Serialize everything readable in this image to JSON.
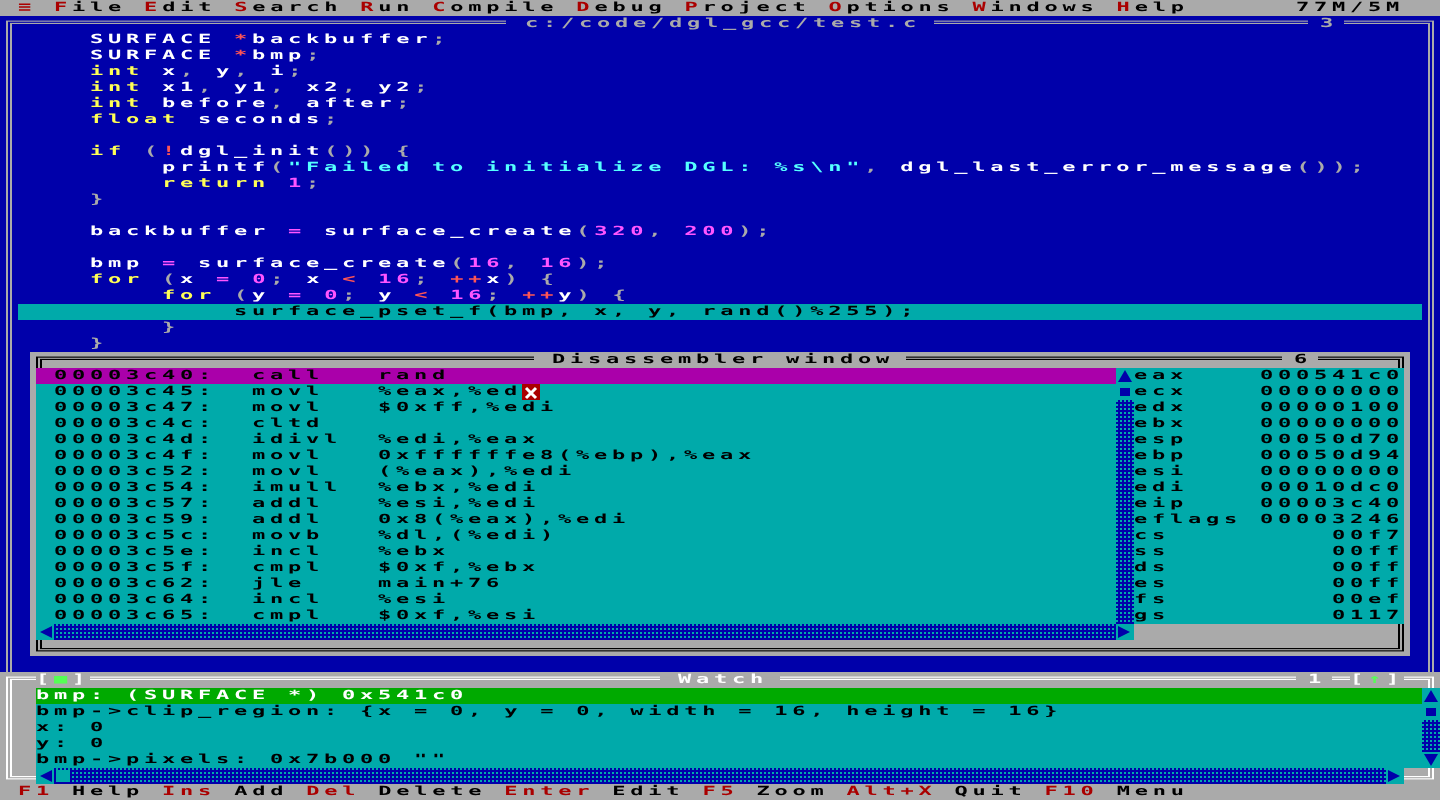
{
  "menu_bar": {
    "items": [
      "≡",
      "File",
      "Edit",
      "Search",
      "Run",
      "Compile",
      "Debug",
      "Project",
      "Options",
      "Windows",
      "Help"
    ],
    "memory": "77M/5M"
  },
  "editor": {
    "title": "c:/code/dgl_gcc/test.c",
    "number": "3",
    "lines": [
      {
        "current": false,
        "tokens": [
          {
            "text": "SURFACE ",
            "kind": "plain"
          },
          {
            "text": "*",
            "kind": "op"
          },
          {
            "text": "backbuffer",
            "kind": "plain"
          },
          {
            "text": ";",
            "kind": "punct"
          }
        ]
      },
      {
        "current": false,
        "tokens": [
          {
            "text": "SURFACE ",
            "kind": "plain"
          },
          {
            "text": "*",
            "kind": "op"
          },
          {
            "text": "bmp",
            "kind": "plain"
          },
          {
            "text": ";",
            "kind": "punct"
          }
        ]
      },
      {
        "current": false,
        "tokens": [
          {
            "text": "int",
            "kind": "keyword"
          },
          {
            "text": " x",
            "kind": "plain"
          },
          {
            "text": ",",
            "kind": "punct"
          },
          {
            "text": " y",
            "kind": "plain"
          },
          {
            "text": ",",
            "kind": "punct"
          },
          {
            "text": " i",
            "kind": "plain"
          },
          {
            "text": ";",
            "kind": "punct"
          }
        ]
      },
      {
        "current": false,
        "tokens": [
          {
            "text": "int",
            "kind": "keyword"
          },
          {
            "text": " x1",
            "kind": "plain"
          },
          {
            "text": ",",
            "kind": "punct"
          },
          {
            "text": " y1",
            "kind": "plain"
          },
          {
            "text": ",",
            "kind": "punct"
          },
          {
            "text": " x2",
            "kind": "plain"
          },
          {
            "text": ",",
            "kind": "punct"
          },
          {
            "text": " y2",
            "kind": "plain"
          },
          {
            "text": ";",
            "kind": "punct"
          }
        ]
      },
      {
        "current": false,
        "tokens": [
          {
            "text": "int",
            "kind": "keyword"
          },
          {
            "text": " before",
            "kind": "plain"
          },
          {
            "text": ",",
            "kind": "punct"
          },
          {
            "text": " after",
            "kind": "plain"
          },
          {
            "text": ";",
            "kind": "punct"
          }
        ]
      },
      {
        "current": false,
        "tokens": [
          {
            "text": "float",
            "kind": "keyword"
          },
          {
            "text": " seconds",
            "kind": "plain"
          },
          {
            "text": ";",
            "kind": "punct"
          }
        ]
      },
      {
        "current": false
      },
      {
        "current": false,
        "tokens": [
          {
            "text": "if",
            "kind": "keyword"
          },
          {
            "text": " (",
            "kind": "punct"
          },
          {
            "text": "!",
            "kind": "op"
          },
          {
            "text": "dgl_init",
            "kind": "plain"
          },
          {
            "text": "()) {",
            "kind": "punct"
          }
        ],
        "children": [
          {
            "current": false,
            "tokens": [
              {
                "text": "printf",
                "kind": "plain"
              },
              {
                "text": "(",
                "kind": "punct"
              },
              {
                "text": "\"Failed to initialize DGL: %s\\n\"",
                "kind": "string"
              },
              {
                "text": ",",
                "kind": "punct"
              },
              {
                "text": " dgl_last_error_message",
                "kind": "plain"
              },
              {
                "text": "());",
                "kind": "punct"
              }
            ]
          },
          {
            "current": false,
            "tokens": [
              {
                "text": "return",
                "kind": "keyword"
              },
              {
                "text": " 1",
                "kind": "number"
              },
              {
                "text": ";",
                "kind": "punct"
              }
            ]
          }
        ]
      },
      {
        "current": false,
        "tokens": [
          {
            "text": "}",
            "kind": "punct"
          }
        ]
      },
      {
        "current": false
      },
      {
        "current": false,
        "tokens": [
          {
            "text": "backbuffer ",
            "kind": "plain"
          },
          {
            "text": "=",
            "kind": "assign"
          },
          {
            "text": " surface_create",
            "kind": "plain"
          },
          {
            "text": "(",
            "kind": "punct"
          },
          {
            "text": "320",
            "kind": "number"
          },
          {
            "text": ", ",
            "kind": "punct"
          },
          {
            "text": "200",
            "kind": "number"
          },
          {
            "text": ");",
            "kind": "punct"
          }
        ]
      },
      {
        "current": false
      },
      {
        "current": false,
        "tokens": [
          {
            "text": "bmp ",
            "kind": "plain"
          },
          {
            "text": "=",
            "kind": "assign"
          },
          {
            "text": " surface_create",
            "kind": "plain"
          },
          {
            "text": "(",
            "kind": "punct"
          },
          {
            "text": "16",
            "kind": "number"
          },
          {
            "text": ", ",
            "kind": "punct"
          },
          {
            "text": "16",
            "kind": "number"
          },
          {
            "text": ");",
            "kind": "punct"
          }
        ]
      },
      {
        "current": false,
        "tokens": [
          {
            "text": "for",
            "kind": "keyword"
          },
          {
            "text": " (",
            "kind": "punct"
          },
          {
            "text": "x ",
            "kind": "plain"
          },
          {
            "text": "=",
            "kind": "assign"
          },
          {
            "text": " 0",
            "kind": "number"
          },
          {
            "text": "; ",
            "kind": "punct"
          },
          {
            "text": "x ",
            "kind": "plain"
          },
          {
            "text": "<",
            "kind": "op"
          },
          {
            "text": " 16",
            "kind": "number"
          },
          {
            "text": "; ",
            "kind": "punct"
          },
          {
            "text": "++",
            "kind": "op"
          },
          {
            "text": "x",
            "kind": "plain"
          },
          {
            "text": ") {",
            "kind": "punct"
          }
        ],
        "children": [
          {
            "current": false,
            "tokens": [
              {
                "text": "for",
                "kind": "keyword"
              },
              {
                "text": " (",
                "kind": "punct"
              },
              {
                "text": "y ",
                "kind": "plain"
              },
              {
                "text": "=",
                "kind": "assign"
              },
              {
                "text": " 0",
                "kind": "number"
              },
              {
                "text": "; ",
                "kind": "punct"
              },
              {
                "text": "y ",
                "kind": "plain"
              },
              {
                "text": "<",
                "kind": "op"
              },
              {
                "text": " 16",
                "kind": "number"
              },
              {
                "text": "; ",
                "kind": "punct"
              },
              {
                "text": "++",
                "kind": "op"
              },
              {
                "text": "y",
                "kind": "plain"
              },
              {
                "text": ") {",
                "kind": "punct"
              }
            ],
            "children": [
              {
                "current": true,
                "text": "surface_pset_f(bmp, x, y, rand()%255);"
              }
            ]
          },
          {
            "current": false,
            "tokens": [
              {
                "text": "}",
                "kind": "punct"
              }
            ]
          }
        ]
      },
      {
        "current": false,
        "tokens": [
          {
            "text": "}",
            "kind": "punct"
          }
        ]
      }
    ]
  },
  "disassembler": {
    "title": "Disassembler window",
    "number": "6",
    "rows": [
      {
        "address": "00003c40:",
        "mnemonic": "call",
        "operand": "rand",
        "current": true,
        "cursor": false
      },
      {
        "address": "00003c45:",
        "mnemonic": "movl",
        "operand": "%eax,%ed",
        "current": false,
        "cursor": true
      },
      {
        "address": "00003c47:",
        "mnemonic": "movl",
        "operand": "$0xff,%edi",
        "current": false,
        "cursor": false
      },
      {
        "address": "00003c4c:",
        "mnemonic": "cltd",
        "current": false,
        "cursor": false
      },
      {
        "address": "00003c4d:",
        "mnemonic": "idivl",
        "operand": "%edi,%eax",
        "current": false,
        "cursor": false
      },
      {
        "address": "00003c4f:",
        "mnemonic": "movl",
        "operand": "0xffffffe8(%ebp),%eax",
        "current": false,
        "cursor": false
      },
      {
        "address": "00003c52:",
        "mnemonic": "movl",
        "operand": "(%eax),%edi",
        "current": false,
        "cursor": false
      },
      {
        "address": "00003c54:",
        "mnemonic": "imull",
        "operand": "%ebx,%edi",
        "current": false,
        "cursor": false
      },
      {
        "address": "00003c57:",
        "mnemonic": "addl",
        "operand": "%esi,%edi",
        "current": false,
        "cursor": false
      },
      {
        "address": "00003c59:",
        "mnemonic": "addl",
        "operand": "0x8(%eax),%edi",
        "current": false,
        "cursor": false
      },
      {
        "address": "00003c5c:",
        "mnemonic": "movb",
        "operand": "%dl,(%edi)",
        "current": false,
        "cursor": false
      },
      {
        "address": "00003c5e:",
        "mnemonic": "incl",
        "operand": "%ebx",
        "current": false,
        "cursor": false
      },
      {
        "address": "00003c5f:",
        "mnemonic": "cmpl",
        "operand": "$0xf,%ebx",
        "current": false,
        "cursor": false
      },
      {
        "address": "00003c62:",
        "mnemonic": "jle",
        "operand": "main+76",
        "current": false,
        "cursor": false
      },
      {
        "address": "00003c64:",
        "mnemonic": "incl",
        "operand": "%esi",
        "current": false,
        "cursor": false
      },
      {
        "address": "00003c65:",
        "mnemonic": "cmpl",
        "operand": "$0xf,%esi",
        "current": false,
        "cursor": false
      }
    ],
    "registers": [
      {
        "name": "eax",
        "value": "000541c0"
      },
      {
        "name": "ecx",
        "value": "00000000"
      },
      {
        "name": "edx",
        "value": "00000100"
      },
      {
        "name": "ebx",
        "value": "00000000"
      },
      {
        "name": "esp",
        "value": "00050d70"
      },
      {
        "name": "ebp",
        "value": "00050d94"
      },
      {
        "name": "esi",
        "value": "00000000"
      },
      {
        "name": "edi",
        "value": "00010dc0"
      },
      {
        "name": "eip",
        "value": "00003c40"
      },
      {
        "name": "eflags",
        "value": "00003246"
      },
      {
        "name": "cs",
        "value": "00f7"
      },
      {
        "name": "ss",
        "value": "00ff"
      },
      {
        "name": "ds",
        "value": "00ff"
      },
      {
        "name": "es",
        "value": "00ff"
      },
      {
        "name": "fs",
        "value": "00ef"
      },
      {
        "name": "gs",
        "value": "0117"
      }
    ]
  },
  "watch": {
    "close_button": "[■]",
    "title": "Watch",
    "number": "1",
    "zoom_button": "[↑]",
    "entries": [
      {
        "text": "bmp: (SURFACE *) 0x541c0",
        "selected": true
      },
      {
        "text": "bmp->clip_region: {x = 0, y = 0, width = 16, height = 16}",
        "selected": false
      },
      {
        "text": "x: 0",
        "selected": false
      },
      {
        "text": "y: 0",
        "selected": false
      },
      {
        "text": "bmp->pixels: 0x7b000 \"\"",
        "selected": false
      }
    ]
  },
  "status_bar": [
    {
      "key": "F1",
      "label": "Help"
    },
    {
      "key": "Ins",
      "label": "Add"
    },
    {
      "key": "Del",
      "label": "Delete"
    },
    {
      "key": "Enter",
      "label": "Edit"
    },
    {
      "key": "F5",
      "label": "Zoom"
    },
    {
      "key": "Alt+X",
      "label": "Quit"
    },
    {
      "key": "F10",
      "label": "Menu"
    }
  ]
}
